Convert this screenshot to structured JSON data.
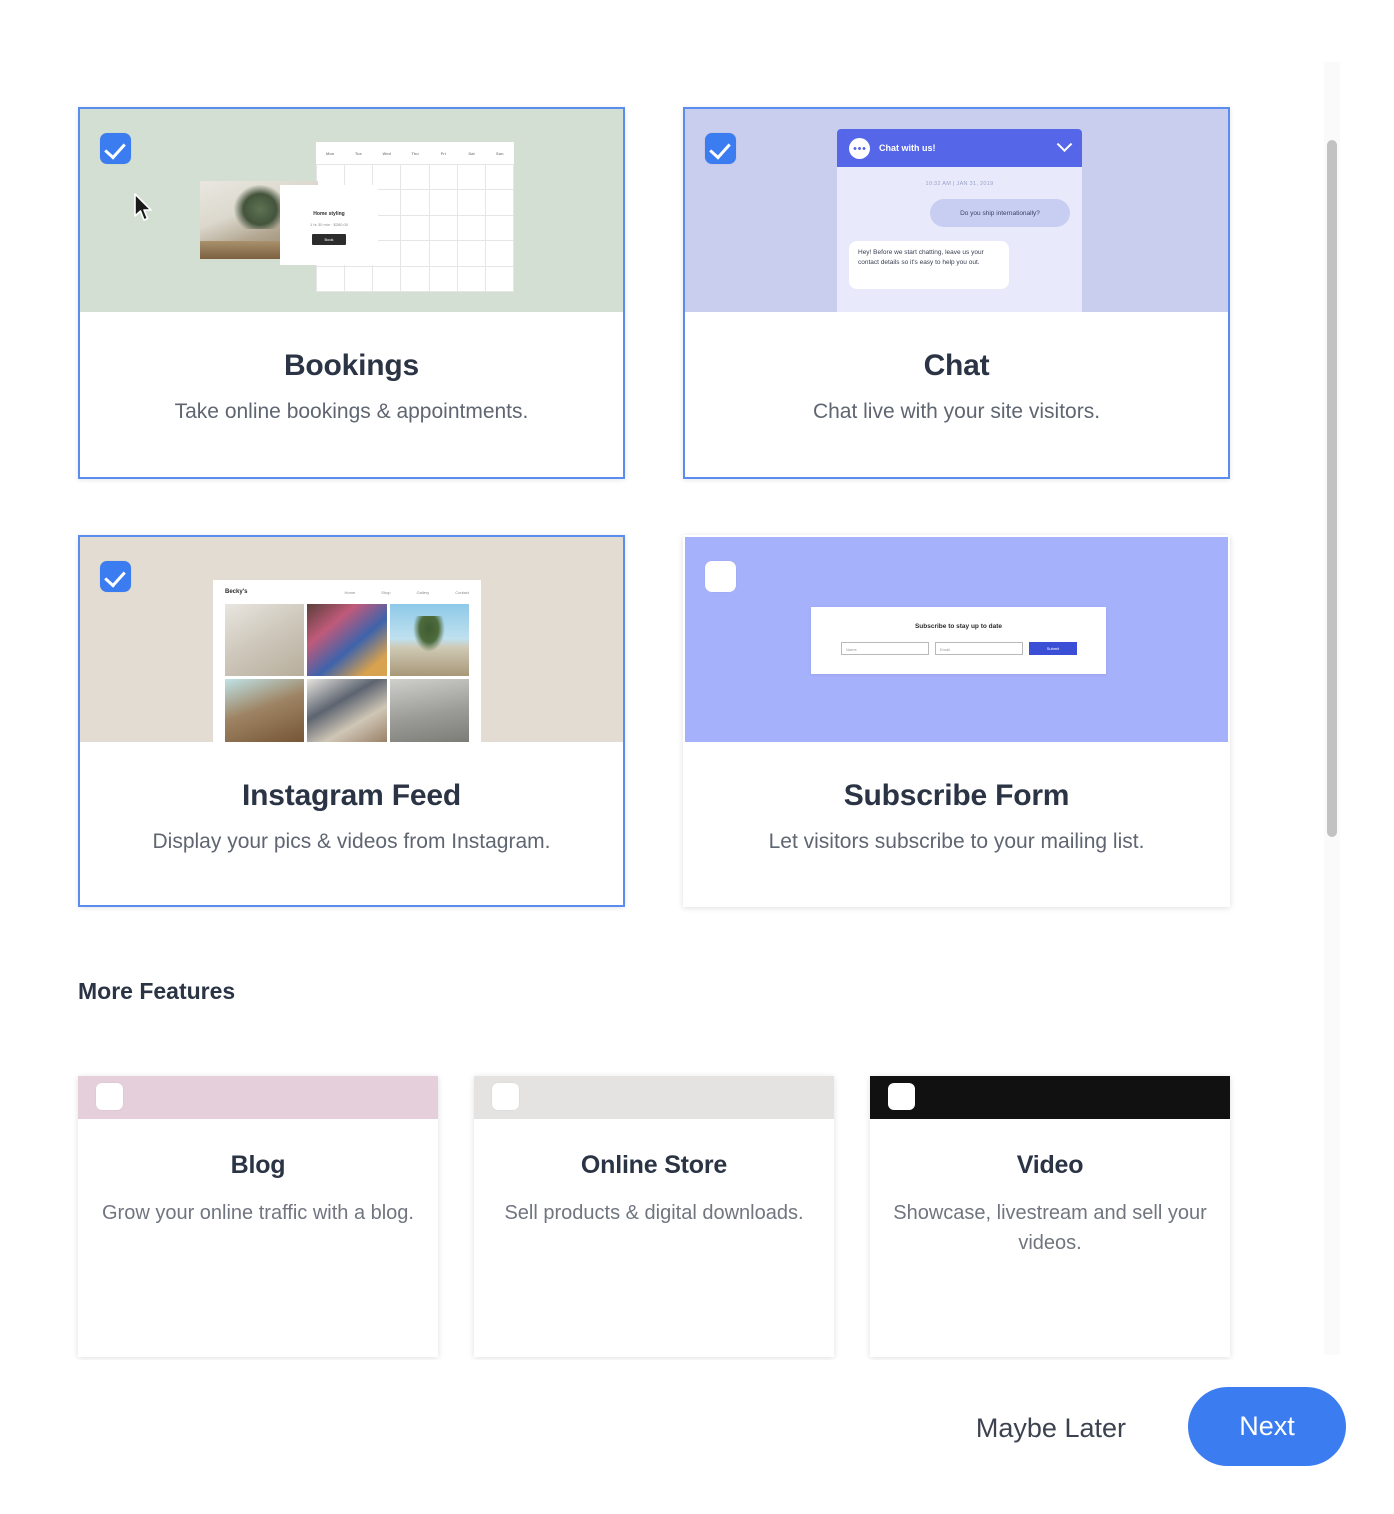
{
  "sections": {
    "more_features_title": "More Features"
  },
  "features": [
    {
      "id": "bookings",
      "title": "Bookings",
      "description": "Take online bookings & appointments.",
      "selected": true,
      "checked": true,
      "banner_color": "#d4dfd3",
      "mockup": {
        "type": "bookings-calendar",
        "calendar_days": [
          "Mon",
          "Tue",
          "Wed",
          "Thu",
          "Fri",
          "Sat",
          "Sun"
        ],
        "card_title": "Home styling",
        "card_subtitle": "1 hr 30 min  ·  $280.00",
        "card_button": "Book"
      }
    },
    {
      "id": "chat",
      "title": "Chat",
      "description": "Chat live with your site visitors.",
      "selected": true,
      "checked": true,
      "banner_color": "#c9cdee",
      "mockup": {
        "type": "chat-widget",
        "header_title": "Chat with us!",
        "timestamp": "10:32 AM  |  JAN 31, 2019",
        "message_visitor": "Do you ship internationally?",
        "message_agent": "Hey! Before we start chatting, leave us your contact details so it's easy to help you out."
      }
    },
    {
      "id": "instagram-feed",
      "title": "Instagram Feed",
      "description": "Display your pics & videos from Instagram.",
      "selected": true,
      "checked": true,
      "banner_color": "#e2dcd2",
      "mockup": {
        "type": "instagram-grid",
        "site_logo": "Becky's",
        "nav_links": [
          "Home",
          "Shop",
          "Gallery",
          "Contact"
        ]
      }
    },
    {
      "id": "subscribe-form",
      "title": "Subscribe Form",
      "description": "Let visitors subscribe to your mailing list.",
      "selected": false,
      "checked": false,
      "banner_color": "#a6b1fb",
      "mockup": {
        "type": "subscribe-form",
        "form_title": "Subscribe to stay up to date",
        "name_placeholder": "Name",
        "email_placeholder": "Email",
        "submit_label": "Submit"
      }
    }
  ],
  "more_features": [
    {
      "id": "blog",
      "title": "Blog",
      "description": "Grow your online traffic with a blog.",
      "checked": false,
      "banner_color": "#e5cfda"
    },
    {
      "id": "online-store",
      "title": "Online Store",
      "description": "Sell products & digital downloads.",
      "checked": false,
      "banner_color": "#e4e3e1"
    },
    {
      "id": "video",
      "title": "Video",
      "description": "Showcase, livestream and sell your videos.",
      "checked": false,
      "banner_color": "#111111"
    }
  ],
  "footer": {
    "maybe_later_label": "Maybe Later",
    "next_label": "Next"
  },
  "colors": {
    "accent_blue": "#3b7df0",
    "selected_border": "#5b8def",
    "title_text": "#2b3445",
    "body_text": "#5f6672",
    "scrollbar_thumb": "#c2c2c2"
  }
}
